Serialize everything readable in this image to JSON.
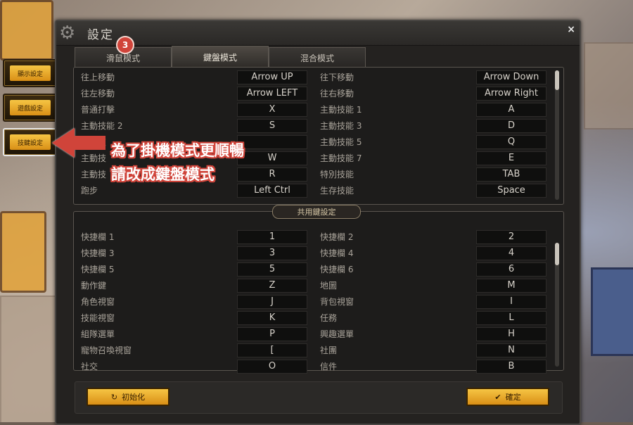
{
  "sidebar": {
    "items": [
      {
        "label": "顯示設定"
      },
      {
        "label": "遊戲設定"
      },
      {
        "label": "技鍵設定"
      }
    ]
  },
  "window": {
    "title": "設定",
    "close_icon": "×"
  },
  "tabs": [
    {
      "label": "滑鼠模式"
    },
    {
      "label": "鍵盤模式"
    },
    {
      "label": "混合模式"
    }
  ],
  "step_badge": "3",
  "keyboard_section": {
    "rows": [
      {
        "left_label": "往上移動",
        "left_key": "Arrow UP",
        "right_label": "往下移動",
        "right_key": "Arrow Down"
      },
      {
        "left_label": "往左移動",
        "left_key": "Arrow LEFT",
        "right_label": "往右移動",
        "right_key": "Arrow Right"
      },
      {
        "left_label": "普通打擊",
        "left_key": "X",
        "right_label": "主動技能 1",
        "right_key": "A"
      },
      {
        "left_label": "主動技能 2",
        "left_key": "S",
        "right_label": "主動技能 3",
        "right_key": "D"
      },
      {
        "left_label": "主動技",
        "left_key": "",
        "right_label": "主動技能 5",
        "right_key": "Q"
      },
      {
        "left_label": "主動技",
        "left_key": "W",
        "right_label": "主動技能 7",
        "right_key": "E"
      },
      {
        "left_label": "主動技",
        "left_key": "R",
        "right_label": "特別技能",
        "right_key": "TAB"
      },
      {
        "left_label": "跑步",
        "left_key": "Left Ctrl",
        "right_label": "生存技能",
        "right_key": "Space"
      }
    ]
  },
  "common_section": {
    "title": "共用鍵設定",
    "rows": [
      {
        "left_label": "快捷欄 1",
        "left_key": "1",
        "right_label": "快捷欄 2",
        "right_key": "2"
      },
      {
        "left_label": "快捷欄 3",
        "left_key": "3",
        "right_label": "快捷欄 4",
        "right_key": "4"
      },
      {
        "left_label": "快捷欄 5",
        "left_key": "5",
        "right_label": "快捷欄 6",
        "right_key": "6"
      },
      {
        "left_label": "動作鍵",
        "left_key": "Z",
        "right_label": "地圖",
        "right_key": "M"
      },
      {
        "left_label": "角色視窗",
        "left_key": "J",
        "right_label": "背包視窗",
        "right_key": "I"
      },
      {
        "left_label": "技能視窗",
        "left_key": "K",
        "right_label": "任務",
        "right_key": "L"
      },
      {
        "left_label": "組隊選單",
        "left_key": "P",
        "right_label": "興趣選單",
        "right_key": "H"
      },
      {
        "left_label": "寵物召喚視窗",
        "left_key": "[",
        "right_label": "社團",
        "right_key": "N"
      },
      {
        "left_label": "社交",
        "left_key": "O",
        "right_label": "信件",
        "right_key": "B"
      }
    ]
  },
  "buttons": {
    "reset_label": "初始化",
    "confirm_label": "確定"
  },
  "annotation": {
    "line1": "為了掛機模式更順暢",
    "line2": "請改成鍵盤模式"
  },
  "colors": {
    "accent": "#d0443a",
    "button_gold": "#f6c544"
  }
}
